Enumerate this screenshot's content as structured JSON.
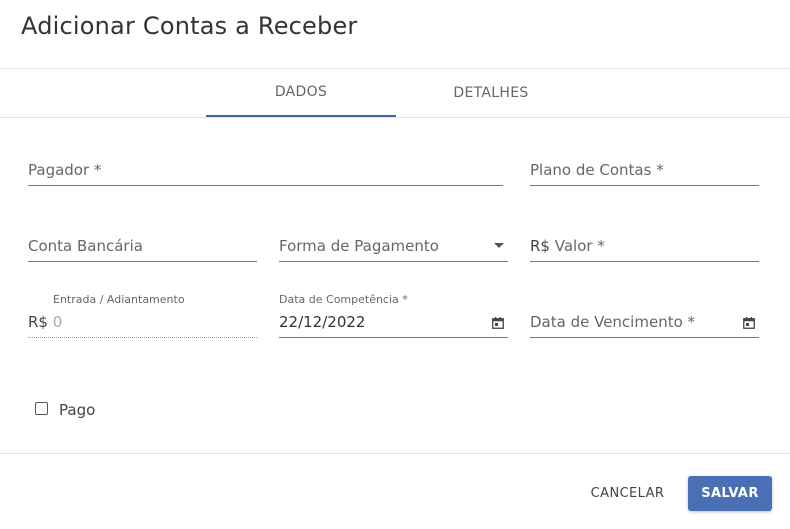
{
  "dialog": {
    "title": "Adicionar Contas a Receber"
  },
  "tabs": [
    {
      "label": "DADOS",
      "active": true
    },
    {
      "label": "DETALHES",
      "active": false
    }
  ],
  "fields": {
    "pagador": {
      "placeholder": "Pagador *"
    },
    "plano_contas": {
      "placeholder": "Plano de Contas *"
    },
    "conta_bancaria": {
      "placeholder": "Conta Bancária"
    },
    "forma_pagamento": {
      "placeholder": "Forma de Pagamento",
      "icon": "caret-down-icon"
    },
    "valor": {
      "prefix": "R$",
      "placeholder": "Valor *"
    },
    "entrada": {
      "label": "Entrada / Adiantamento",
      "prefix": "R$",
      "value": "0"
    },
    "data_competencia": {
      "label": "Data de Competência *",
      "value": "22/12/2022",
      "icon": "calendar-icon"
    },
    "data_vencimento": {
      "placeholder": "Data de Vencimento *",
      "icon": "calendar-icon"
    }
  },
  "pago": {
    "label": "Pago",
    "checked": false
  },
  "actions": {
    "cancel": "CANCELAR",
    "save": "SALVAR"
  },
  "colors": {
    "accent": "#3f64a8",
    "button": "#4a6fb5"
  }
}
